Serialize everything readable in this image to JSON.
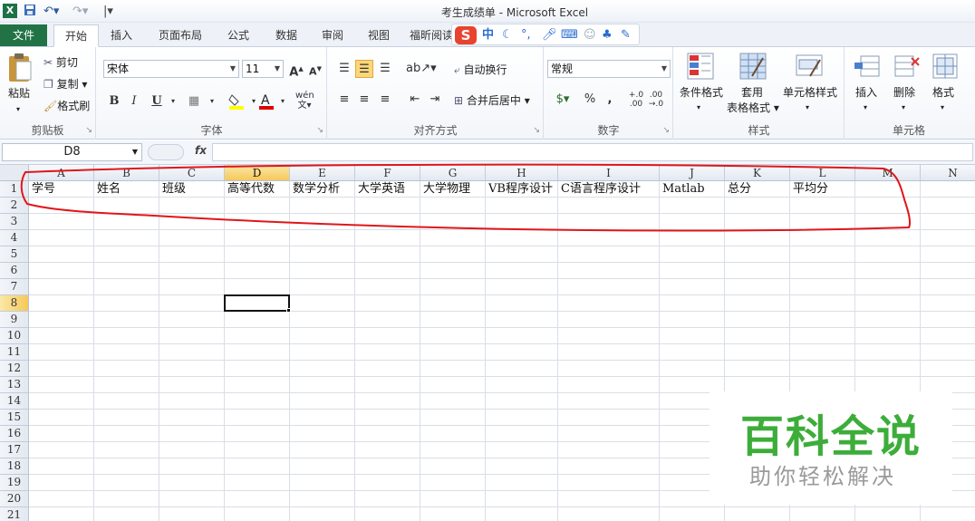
{
  "title_bar": {
    "title": "考生成绩单 - Microsoft Excel"
  },
  "tabs": [
    "文件",
    "开始",
    "插入",
    "页面布局",
    "公式",
    "数据",
    "审阅",
    "视图",
    "福昕阅读"
  ],
  "active_tab": "开始",
  "ime_toolbar": {
    "logo": "S",
    "mode": "中"
  },
  "ribbon": {
    "clipboard": {
      "label": "剪贴板",
      "paste": "粘贴",
      "cut": "剪切",
      "copy": "复制",
      "format_painter": "格式刷"
    },
    "font": {
      "label": "字体",
      "name": "宋体",
      "size": "11",
      "bold": "B",
      "italic": "I",
      "underline": "U"
    },
    "alignment": {
      "label": "对齐方式",
      "wrap_text": "自动换行",
      "merge_center": "合并后居中"
    },
    "number": {
      "label": "数字",
      "format": "常规",
      "percent": "%",
      "comma": ","
    },
    "styles": {
      "label": "样式",
      "conditional": "条件格式",
      "table_line1": "套用",
      "table_line2": "表格格式",
      "cell_styles": "单元格样式"
    },
    "cells": {
      "label": "单元格",
      "insert": "插入",
      "delete": "删除",
      "format": "格式"
    }
  },
  "formula_bar": {
    "name_box": "D8",
    "fx": "fx",
    "value": ""
  },
  "sheet": {
    "columns": [
      "A",
      "B",
      "C",
      "D",
      "E",
      "F",
      "G",
      "H",
      "I",
      "J",
      "K",
      "L",
      "M",
      "N"
    ],
    "selected_column": "D",
    "rows": [
      "1",
      "2",
      "3",
      "4",
      "5",
      "6",
      "7",
      "8",
      "9",
      "10",
      "11",
      "12",
      "13",
      "14",
      "15",
      "16",
      "17",
      "18",
      "19",
      "20",
      "21"
    ],
    "selected_row": "8",
    "row1": [
      "学号",
      "姓名",
      "班级",
      "高等代数",
      "数学分析",
      "大学英语",
      "大学物理",
      "VB程序设计",
      "C语言程序设计",
      "Matlab",
      "总分",
      "平均分"
    ],
    "active_cell": "D8"
  },
  "watermark": {
    "main": "百科全说",
    "sub": "助你轻松解决"
  },
  "colors": {
    "file_tab": "#217346",
    "annotation": "#e0161b",
    "selected_header": "#f6c85a",
    "watermark_green": "#3dad3a"
  }
}
